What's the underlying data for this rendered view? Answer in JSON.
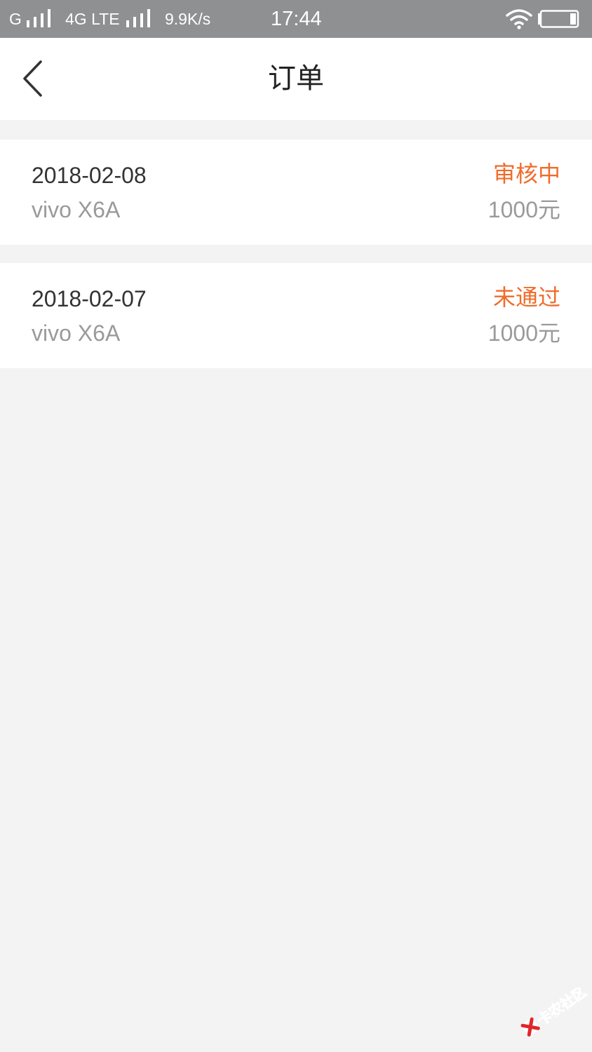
{
  "status_bar": {
    "carrier_1": "G",
    "carrier_2": "4G LTE",
    "net_speed": "9.9K/s",
    "time": "17:44",
    "icons": [
      "signal-icon",
      "wifi-icon",
      "battery-icon"
    ]
  },
  "header": {
    "title": "订单",
    "back_icon": "chevron-left-icon"
  },
  "orders": [
    {
      "date": "2018-02-08",
      "product": "vivo X6A",
      "status": "审核中",
      "amount": "1000元"
    },
    {
      "date": "2018-02-07",
      "product": "vivo X6A",
      "status": "未通过",
      "amount": "1000元"
    }
  ],
  "watermark": {
    "text": "卡农社区"
  },
  "colors": {
    "status_bar_bg": "#8e9091",
    "page_bg": "#f2f3f2",
    "status_accent": "#ef6c2b",
    "secondary_text": "#9a9a9a",
    "primary_text": "#333333"
  }
}
